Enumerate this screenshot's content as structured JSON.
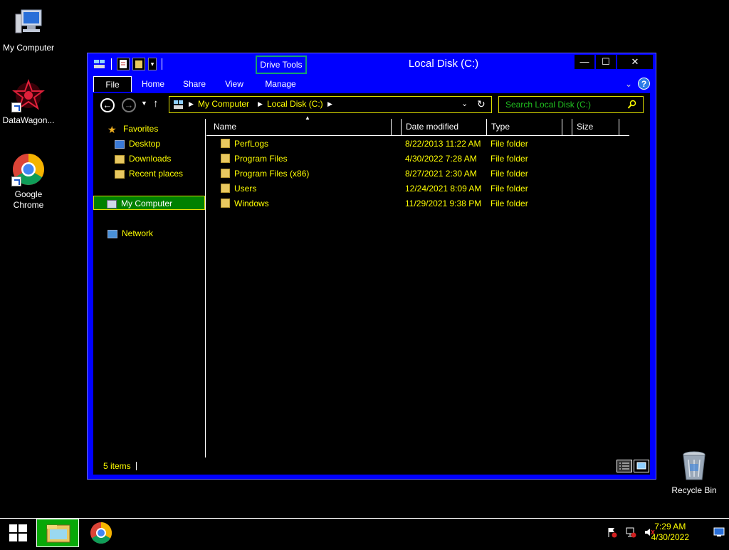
{
  "desktop": {
    "icons": [
      {
        "label": "My Computer"
      },
      {
        "label": "DataWagon..."
      },
      {
        "label": "Google Chrome"
      },
      {
        "label": "Recycle Bin"
      }
    ]
  },
  "window": {
    "title": "Local Disk (C:)",
    "context_tab": "Drive Tools",
    "controls": {
      "minimize": "—",
      "maximize": "☐",
      "close": "✕"
    },
    "ribbon_tabs": [
      "File",
      "Home",
      "Share",
      "View",
      "Manage"
    ],
    "help": "?",
    "address": {
      "breadcrumbs": [
        "My Computer",
        "Local Disk (C:)"
      ]
    },
    "search": {
      "placeholder": "Search Local Disk (C:)"
    },
    "nav": {
      "favorites": "Favorites",
      "items": [
        "Desktop",
        "Downloads",
        "Recent places"
      ],
      "computer": "My Computer",
      "network": "Network"
    },
    "columns": [
      "Name",
      "Date modified",
      "Type",
      "Size"
    ],
    "files": [
      {
        "name": "PerfLogs",
        "date": "8/22/2013 11:22 AM",
        "type": "File folder",
        "size": ""
      },
      {
        "name": "Program Files",
        "date": "4/30/2022 7:28 AM",
        "type": "File folder",
        "size": ""
      },
      {
        "name": "Program Files (x86)",
        "date": "8/27/2021 2:30 AM",
        "type": "File folder",
        "size": ""
      },
      {
        "name": "Users",
        "date": "12/24/2021 8:09 AM",
        "type": "File folder",
        "size": ""
      },
      {
        "name": "Windows",
        "date": "11/29/2021 9:38 PM",
        "type": "File folder",
        "size": ""
      }
    ],
    "status": {
      "item_count": "5 items"
    }
  },
  "taskbar": {
    "clock_time": "7:29 AM",
    "clock_date": "4/30/2022"
  },
  "colors": {
    "window_frame": "#0000ff",
    "text_yellow": "#ffff00",
    "selection_green": "#008000",
    "search_text": "#20c020"
  }
}
